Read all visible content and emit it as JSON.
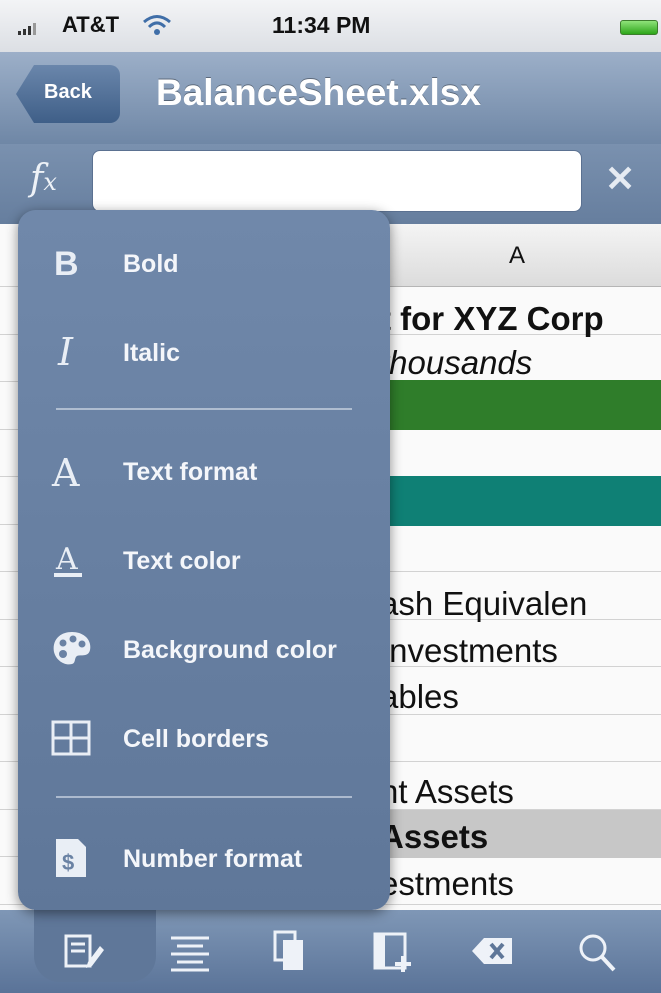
{
  "status_bar": {
    "carrier": "AT&T",
    "time": "11:34 PM"
  },
  "nav": {
    "back_label": "Back",
    "title": "BalanceSheet.xlsx"
  },
  "formula": {
    "fx_label": "fx",
    "value": "",
    "close_label": "✕"
  },
  "sheet": {
    "column_header": "A",
    "rows": [
      {
        "text": "t for XYZ Corp",
        "style": "bold"
      },
      {
        "text": "thousands",
        "style": "italic"
      },
      {
        "text": "ash Equivalen",
        "style": "normal"
      },
      {
        "text": "Investments",
        "style": "normal"
      },
      {
        "text": "ables",
        "style": "normal"
      },
      {
        "text": "nt Assets",
        "style": "normal"
      },
      {
        "text": "Assets",
        "style": "bold"
      },
      {
        "text": "estments",
        "style": "normal"
      }
    ],
    "colors": {
      "green_band": "#2f7d2a",
      "teal_band": "#0f8075",
      "gray_band": "#c7c7c7"
    }
  },
  "menu": {
    "items": [
      {
        "label": "Bold",
        "icon": "bold-icon"
      },
      {
        "label": "Italic",
        "icon": "italic-icon"
      },
      {
        "label": "Text format",
        "icon": "text-format-icon"
      },
      {
        "label": "Text color",
        "icon": "text-color-icon"
      },
      {
        "label": "Background color",
        "icon": "palette-icon"
      },
      {
        "label": "Cell borders",
        "icon": "cell-borders-icon"
      },
      {
        "label": "Number format",
        "icon": "number-format-icon"
      }
    ]
  },
  "toolbar": {
    "icons": [
      "format-icon",
      "align-icon",
      "copy-icon",
      "insert-icon",
      "delete-icon",
      "search-icon"
    ]
  }
}
